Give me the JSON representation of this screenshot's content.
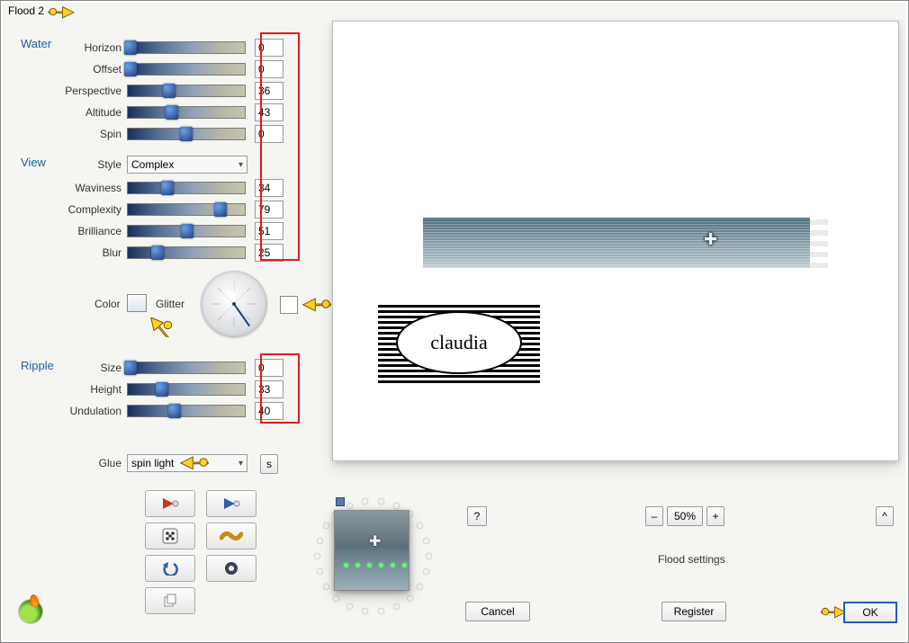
{
  "window": {
    "title": "Flood 2"
  },
  "sections": {
    "water": {
      "header": "Water",
      "sliders": [
        {
          "label": "Horizon",
          "value": "0",
          "pos": 2
        },
        {
          "label": "Offset",
          "value": "0",
          "pos": 2
        },
        {
          "label": "Perspective",
          "value": "36",
          "pos": 35
        },
        {
          "label": "Altitude",
          "value": "43",
          "pos": 38
        },
        {
          "label": "Spin",
          "value": "0",
          "pos": 50
        }
      ]
    },
    "view": {
      "header": "View",
      "style_label": "Style",
      "style_value": "Complex",
      "sliders": [
        {
          "label": "Waviness",
          "value": "34",
          "pos": 34
        },
        {
          "label": "Complexity",
          "value": "79",
          "pos": 79
        },
        {
          "label": "Brilliance",
          "value": "51",
          "pos": 51
        },
        {
          "label": "Blur",
          "value": "25",
          "pos": 25
        }
      ],
      "color_label": "Color",
      "glitter_label": "Glitter"
    },
    "ripple": {
      "header": "Ripple",
      "sliders": [
        {
          "label": "Size",
          "value": "0",
          "pos": 2
        },
        {
          "label": "Height",
          "value": "33",
          "pos": 29
        },
        {
          "label": "Undulation",
          "value": "40",
          "pos": 40
        }
      ]
    },
    "glue": {
      "label": "Glue",
      "value": "spin light",
      "s_button": "s"
    }
  },
  "logo_text": "claudia",
  "footer": {
    "help": "?",
    "zoom_minus": "–",
    "zoom_value": "50%",
    "zoom_plus": "+",
    "caret": "^",
    "settings_label": "Flood settings",
    "cancel": "Cancel",
    "register": "Register",
    "ok": "OK"
  }
}
